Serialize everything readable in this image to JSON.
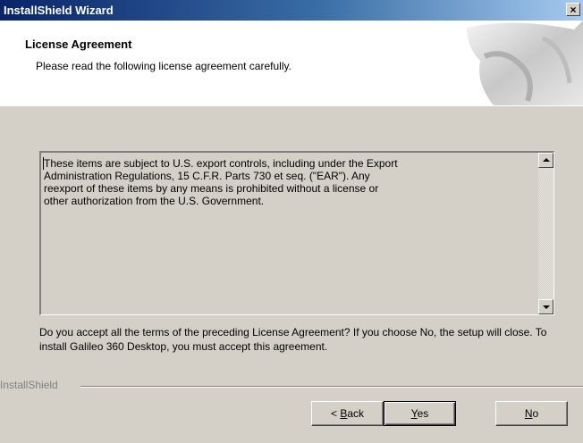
{
  "window": {
    "title": "InstallShield Wizard",
    "close_glyph": "×"
  },
  "header": {
    "title": "License Agreement",
    "subtitle": "Please read the following license agreement carefully."
  },
  "license": {
    "text": "These items are subject to U.S. export controls, including under the Export\nAdministration Regulations, 15 C.F.R. Parts 730 et seq. (\"EAR\").  Any\nreexport of these items by any means is prohibited without a license or\nother authorization from the U.S. Government."
  },
  "question": {
    "text": "Do you accept all the terms of the preceding License Agreement?  If you choose No,  the setup will close.  To install Galileo 360 Desktop, you must accept this agreement."
  },
  "branding": {
    "label": "InstallShield"
  },
  "buttons": {
    "back_prefix": "< ",
    "back_mnemonic": "B",
    "back_rest": "ack",
    "yes_mnemonic": "Y",
    "yes_rest": "es",
    "no_mnemonic": "N",
    "no_rest": "o"
  },
  "colors": {
    "titlebar_start": "#0a246a",
    "titlebar_end": "#a6caf0",
    "dialog_face": "#d4d0c8"
  }
}
